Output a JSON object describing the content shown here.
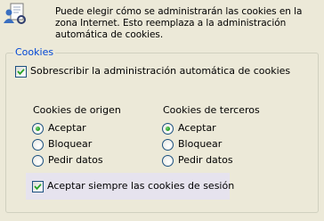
{
  "intro": {
    "text": "Puede elegir cómo se administrarán las cookies en la zona Internet. Esto reemplaza a la administración automática de cookies.",
    "icon": "privacy-cookie-icon"
  },
  "cookies_group": {
    "legend": "Cookies",
    "override": {
      "label": "Sobrescribir la administración automática de cookies",
      "checked": true
    },
    "first_party": {
      "title": "Cookies de origen",
      "options": [
        "Aceptar",
        "Bloquear",
        "Pedir datos"
      ],
      "selected": "Aceptar"
    },
    "third_party": {
      "title": "Cookies de terceros",
      "options": [
        "Aceptar",
        "Bloquear",
        "Pedir datos"
      ],
      "selected": "Aceptar"
    },
    "session": {
      "label": "Aceptar siempre las cookies de sesión",
      "checked": true
    }
  },
  "colors": {
    "window_bg": "#ECE9D8",
    "legend_text": "#0046D5",
    "control_border": "#1C5180",
    "radio_dot": "#21A121",
    "check_mark": "#21A121",
    "group_border": "#D0D0BF"
  }
}
